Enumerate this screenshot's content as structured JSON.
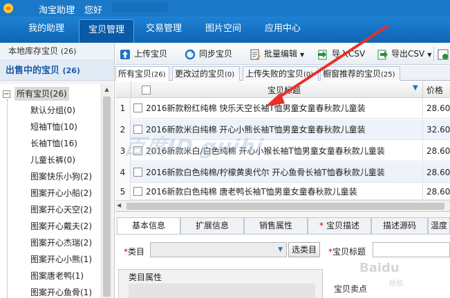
{
  "titlebar": {
    "app_name": "淘宝助理",
    "separator": "-",
    "greeting": "您好"
  },
  "menu": [
    {
      "label": "我的助理"
    },
    {
      "label": "宝贝管理"
    },
    {
      "label": "交易管理"
    },
    {
      "label": "图片空间"
    },
    {
      "label": "应用中心"
    }
  ],
  "sidebar": {
    "local": {
      "label": "本地库存宝贝",
      "count": "(26)"
    },
    "on_sale": {
      "label": "出售中的宝贝",
      "count": "(26)"
    },
    "tree_toggle": "−",
    "root": "所有宝贝(26)",
    "items": [
      "默认分组(0)",
      "短袖T恤(10)",
      "长袖T恤(16)",
      "儿童长裤(0)",
      "图案快乐小狗(2)",
      "图案开心小船(2)",
      "图案开心天空(2)",
      "图案开心戴夫(2)",
      "图案开心杰瑞(2)",
      "图案开心小熊(1)",
      "图案唐老鸭(1)",
      "图案开心鱼骨(1)"
    ]
  },
  "toolbar": {
    "upload": "上传宝贝",
    "sync": "同步宝贝",
    "batch_edit": "批量编辑",
    "import_csv": "导入CSV",
    "export_csv": "导出CSV"
  },
  "tabs": [
    {
      "label": "所有宝贝",
      "count": "(26)"
    },
    {
      "label": "更改过的宝贝",
      "count": "(0)"
    },
    {
      "label": "上传失败的宝贝",
      "count": "(0)"
    },
    {
      "label": "橱窗推荐的宝贝",
      "count": "(25)"
    }
  ],
  "grid": {
    "col_title": "宝贝标题",
    "col_price": "价格",
    "filter_icon": "▼",
    "rows": [
      {
        "num": "1",
        "title": "2016新款粉红纯棉 快乐天空长袖T恤男童女童春秋款儿童装",
        "price": "28.60"
      },
      {
        "num": "2",
        "title": "2016新款米白纯棉 开心小熊长袖T恤男童女童春秋款儿童装",
        "price": "32.60"
      },
      {
        "num": "3",
        "title": "2016新款米白/白色纯棉 开心小猴长袖T恤男童女童春秋款儿童装",
        "price": "28.60"
      },
      {
        "num": "4",
        "title": "2016新款白色纯棉/柠檬黄奥代尔 开心鱼骨长袖T恤春秋款儿童装",
        "price": "28.60"
      },
      {
        "num": "5",
        "title": "2016新款白色纯棉 唐老鸭长袖T恤男童女童春秋款儿童装",
        "price": "28.60"
      }
    ]
  },
  "detail": {
    "tabs": [
      {
        "label": "基本信息",
        "required": false
      },
      {
        "label": "扩展信息",
        "required": false
      },
      {
        "label": "销售属性",
        "required": false
      },
      {
        "label": "宝贝描述",
        "required": true
      },
      {
        "label": "描述源码",
        "required": false
      },
      {
        "label": "温度",
        "required": false
      }
    ],
    "category_label": "类目",
    "select_category": "选类目",
    "title_label": "宝贝标题",
    "category_attrs": "类目属性",
    "selling_points": "宝贝卖点",
    "required_mark": "*"
  },
  "watermark": {
    "main": "百度ID guihi",
    "corner": "Baidu",
    "corner_sub": "经验"
  },
  "colors": {
    "titlebar": "#1b78c8",
    "menubar": "#1170c0",
    "sidebar_active": "#1a58a3",
    "row_alt": "#eef3fb",
    "annotation_arrow": "#e8302a"
  }
}
